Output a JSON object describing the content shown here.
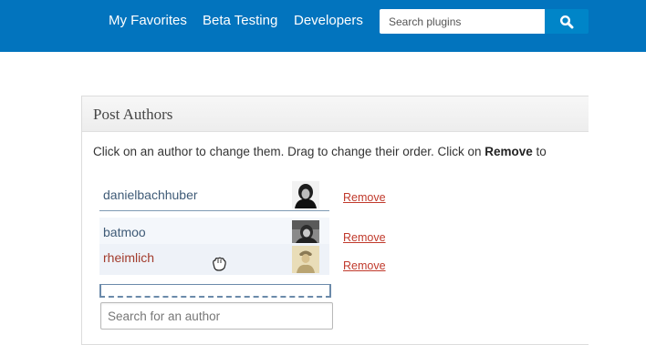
{
  "nav": {
    "links": [
      "My Favorites",
      "Beta Testing",
      "Developers"
    ],
    "search": {
      "placeholder": "Search plugins",
      "value": ""
    },
    "search_icon": "magnifier-icon"
  },
  "colors": {
    "topbar": "#0274be",
    "search_button": "#0085c8",
    "author_link": "#3f5b77",
    "dragging_author": "#a23b2c",
    "remove_link": "#c0392b"
  },
  "post_authors": {
    "title": "Post Authors",
    "instructions_prefix": "Click on an author to change them. Drag to change their order. Click on ",
    "instructions_bold": "Remove",
    "instructions_suffix": " to",
    "authors": [
      {
        "name": "danielbachhuber",
        "remove_label": "Remove"
      },
      {
        "name": "batmoo",
        "remove_label": "Remove"
      },
      {
        "name": "rheimlich",
        "remove_label": "Remove"
      }
    ],
    "search": {
      "placeholder": "Search for an author",
      "value": ""
    }
  }
}
